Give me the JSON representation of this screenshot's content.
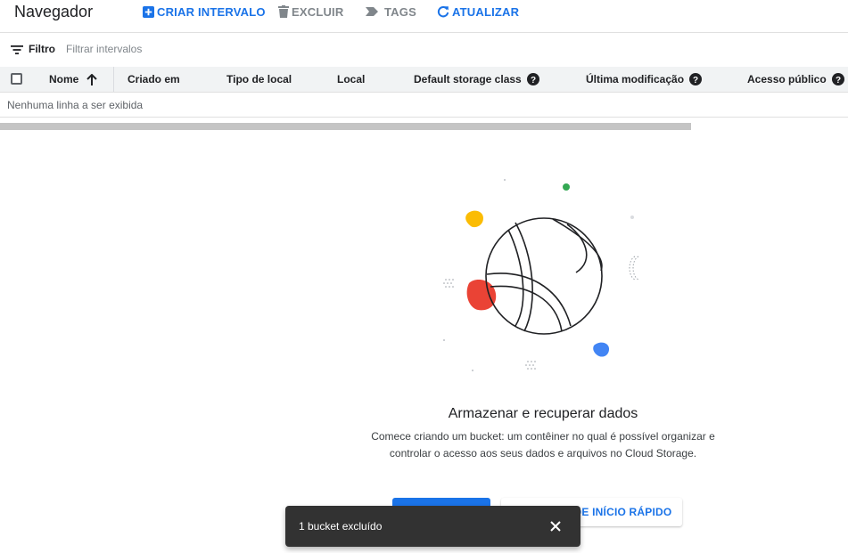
{
  "toolbar": {
    "title": "Navegador",
    "create_label": "CRIAR INTERVALO",
    "delete_label": "EXCLUIR",
    "tags_label": "TAGS",
    "refresh_label": "ATUALIZAR"
  },
  "filter": {
    "label": "Filtro",
    "placeholder": "Filtrar intervalos"
  },
  "table": {
    "columns": {
      "name": "Nome",
      "created": "Criado em",
      "location_type": "Tipo de local",
      "location": "Local",
      "storage_class": "Default storage class",
      "modified": "Última modificação",
      "public_access": "Acesso público"
    },
    "empty_message": "Nenhuma linha a ser exibida"
  },
  "empty_state": {
    "title": "Armazenar e recuperar dados",
    "description": "Comece criando um bucket: um contêiner no qual é possível organizar e controlar o acesso aos seus dados e arquivos no Cloud Storage.",
    "guide_button": "DE INÍCIO RÁPIDO"
  },
  "snackbar": {
    "message": "1 bucket excluído"
  },
  "colors": {
    "accent": "#1a73e8",
    "snackbar_bg": "#323232",
    "illus_red": "#ea4335",
    "illus_yellow": "#fbbc04",
    "illus_green": "#34a853",
    "illus_blue": "#4285f4"
  }
}
